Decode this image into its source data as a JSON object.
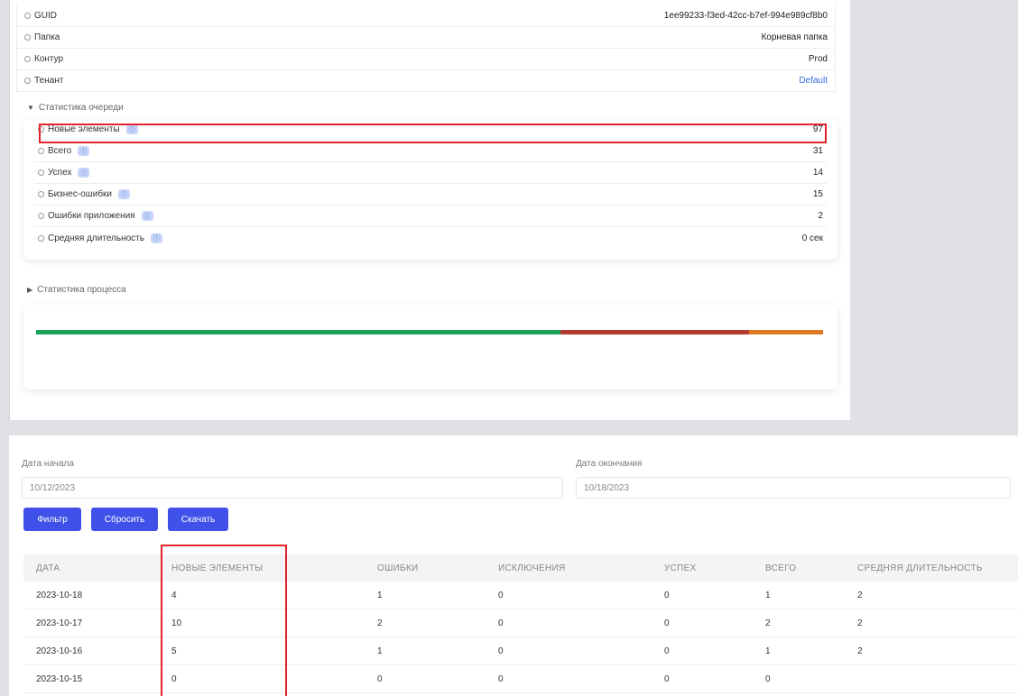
{
  "properties": [
    {
      "label": "GUID",
      "value": "1ee99233-f3ed-42cc-b7ef-994e989cf8b0",
      "link": false
    },
    {
      "label": "Папка",
      "value": "Корневая папка",
      "link": false
    },
    {
      "label": "Контур",
      "value": "Prod",
      "link": false
    },
    {
      "label": "Тенант",
      "value": "Default",
      "link": true
    }
  ],
  "queue_stats": {
    "title": "Статистика очереди",
    "help_icon": "help-circle-icon",
    "rows": [
      {
        "label": "Новые элементы",
        "value": "97"
      },
      {
        "label": "Всего",
        "value": "31"
      },
      {
        "label": "Успех",
        "value": "14"
      },
      {
        "label": "Бизнес-ошибки",
        "value": "15"
      },
      {
        "label": "Ошибки приложения",
        "value": "2"
      },
      {
        "label": "Средняя длительность",
        "value": "0 сек"
      }
    ]
  },
  "process_stats": {
    "title": "Статистика процесса",
    "bar_segments": [
      {
        "name": "success",
        "fraction": 0.6667,
        "color": "#1aa35a"
      },
      {
        "name": "business-errors",
        "fraction": 0.2397,
        "color": "#b33a2e"
      },
      {
        "name": "app-errors",
        "fraction": 0.0936,
        "color": "#e07b24"
      }
    ]
  },
  "filters": {
    "start_label": "Дата начала",
    "start_value": "10/12/2023",
    "end_label": "Дата окончания",
    "end_value": "10/18/2023",
    "filter_btn": "Фильтр",
    "reset_btn": "Сбросить",
    "download_btn": "Скачать"
  },
  "table": {
    "headers": [
      "ДАТА",
      "НОВЫЕ ЭЛЕМЕНТЫ",
      "ОШИБКИ",
      "ИСКЛЮЧЕНИЯ",
      "УСПЕХ",
      "ВСЕГО",
      "СРЕДНЯЯ ДЛИТЕЛЬНОСТЬ"
    ],
    "rows": [
      [
        "2023-10-18",
        "4",
        "1",
        "0",
        "0",
        "1",
        "2"
      ],
      [
        "2023-10-17",
        "10",
        "2",
        "0",
        "0",
        "2",
        "2"
      ],
      [
        "2023-10-16",
        "5",
        "1",
        "0",
        "0",
        "1",
        "2"
      ],
      [
        "2023-10-15",
        "0",
        "0",
        "0",
        "0",
        "0",
        ""
      ]
    ]
  },
  "colors": {
    "accent": "#3f51e8",
    "highlight": "#e3242b",
    "link": "#3b6ee0"
  }
}
